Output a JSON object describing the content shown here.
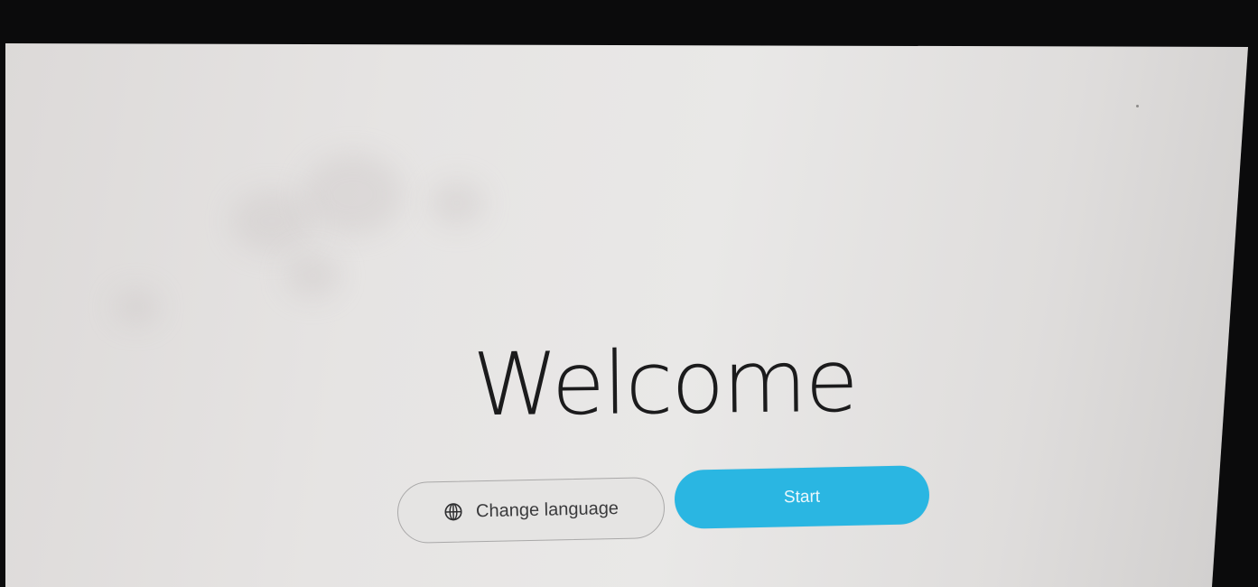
{
  "welcome": {
    "title": "Welcome"
  },
  "actions": {
    "change_language_label": "Change language",
    "start_label": "Start"
  },
  "icons": {
    "language": "globe-icon"
  },
  "colors": {
    "start_button": "#2ab6e2",
    "background": "#e7e6e5",
    "title_text": "#1b1b1c"
  }
}
